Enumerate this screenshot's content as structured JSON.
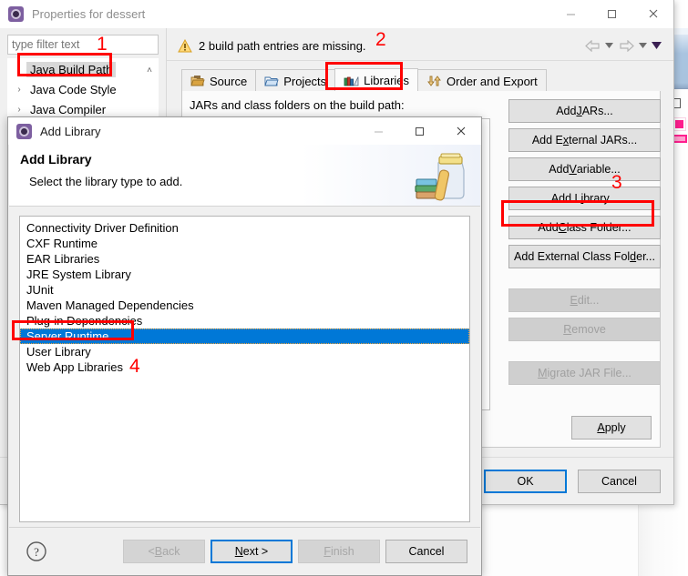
{
  "background": {
    "blue_panel": "#a9c4e0",
    "pink_accent": "#ff1f8f"
  },
  "properties_window": {
    "title": "Properties for dessert",
    "icon": "eclipse-icon",
    "window_buttons": [
      {
        "name": "minimize-button",
        "glyph": "minimize-icon"
      },
      {
        "name": "maximize-button",
        "glyph": "maximize-icon"
      },
      {
        "name": "close-button",
        "glyph": "close-icon"
      }
    ],
    "filter": {
      "value": "",
      "placeholder": "type filter text"
    },
    "tree": {
      "scroll_up_glyph": "˄",
      "items": [
        {
          "label": "Java Build Path",
          "expandable": false,
          "selected": true
        },
        {
          "label": "Java Code Style",
          "expandable": true,
          "selected": false
        },
        {
          "label": "Java Compiler",
          "expandable": true,
          "selected": false
        }
      ]
    },
    "warning": {
      "icon": "warning-icon",
      "text": "2 build path entries are missing."
    },
    "nav": [
      {
        "name": "back-arrow-icon",
        "glyph": "⇦"
      },
      {
        "name": "back-dropdown-icon",
        "glyph": "▾"
      },
      {
        "name": "forward-arrow-icon",
        "glyph": "⇨"
      },
      {
        "name": "forward-dropdown-icon",
        "glyph": "▾"
      },
      {
        "name": "menu-dropdown-icon",
        "glyph": "▾"
      }
    ],
    "tabs": [
      {
        "label": "Source",
        "icon": "source-folder-icon",
        "active": false
      },
      {
        "label": "Projects",
        "icon": "projects-folder-icon",
        "active": false
      },
      {
        "label": "Libraries",
        "icon": "libraries-books-icon",
        "active": true
      },
      {
        "label": "Order and Export",
        "icon": "order-export-icon",
        "active": false
      }
    ],
    "panel_label": "JARs and class folders on the build path:",
    "side_buttons": [
      {
        "label": "Add JARs...",
        "mnemonic": "J",
        "enabled": true,
        "highlighted": false
      },
      {
        "label": "Add External JARs...",
        "mnemonic": "x",
        "enabled": true,
        "highlighted": false
      },
      {
        "label": "Add Variable...",
        "mnemonic": "V",
        "enabled": true,
        "highlighted": false
      },
      {
        "label": "Add Library...",
        "mnemonic": "i",
        "enabled": true,
        "highlighted": true
      },
      {
        "label": "Add Class Folder...",
        "mnemonic": "C",
        "enabled": true,
        "highlighted": false
      },
      {
        "label": "Add External Class Folder...",
        "mnemonic": "d",
        "enabled": true,
        "highlighted": false
      },
      {
        "label": "Edit...",
        "mnemonic": "E",
        "enabled": false,
        "highlighted": false
      },
      {
        "label": "Remove",
        "mnemonic": "R",
        "enabled": false,
        "highlighted": false
      },
      {
        "label": "Migrate JAR File...",
        "mnemonic": "M",
        "enabled": false,
        "highlighted": false
      }
    ],
    "apply_label": "Apply",
    "ok_label": "OK",
    "cancel_label": "Cancel"
  },
  "add_library_dialog": {
    "title": "Add Library",
    "icon": "eclipse-icon",
    "heading": "Add Library",
    "subheading": "Select the library type to add.",
    "illustration": "jar-with-books-icon",
    "window_buttons": [
      {
        "name": "minimize-button",
        "glyph": "minimize-icon"
      },
      {
        "name": "maximize-button",
        "glyph": "maximize-icon"
      },
      {
        "name": "close-button",
        "glyph": "close-icon"
      }
    ],
    "library_types": [
      {
        "label": "Connectivity Driver Definition",
        "selected": false
      },
      {
        "label": "CXF Runtime",
        "selected": false
      },
      {
        "label": "EAR Libraries",
        "selected": false
      },
      {
        "label": "JRE System Library",
        "selected": false
      },
      {
        "label": "JUnit",
        "selected": false
      },
      {
        "label": "Maven Managed Dependencies",
        "selected": false
      },
      {
        "label": "Plug-in Dependencies",
        "selected": false
      },
      {
        "label": "Server Runtime",
        "selected": true
      },
      {
        "label": "User Library",
        "selected": false
      },
      {
        "label": "Web App Libraries",
        "selected": false
      }
    ],
    "help_icon": "help-question-icon",
    "buttons": [
      {
        "label": "< Back",
        "mnemonic": "B",
        "enabled": false,
        "focused": false
      },
      {
        "label": "Next >",
        "mnemonic": "N",
        "enabled": true,
        "focused": true
      },
      {
        "label": "Finish",
        "mnemonic": "F",
        "enabled": false,
        "focused": false
      },
      {
        "label": "Cancel",
        "mnemonic": "",
        "enabled": true,
        "focused": false
      }
    ]
  },
  "annotations": {
    "color": "#ff0000",
    "markers": [
      {
        "number": "1",
        "target": "java-build-path-tree-item"
      },
      {
        "number": "2",
        "target": "libraries-tab"
      },
      {
        "number": "3",
        "target": "add-library-button"
      },
      {
        "number": "4",
        "target": "server-runtime-list-item"
      }
    ]
  }
}
